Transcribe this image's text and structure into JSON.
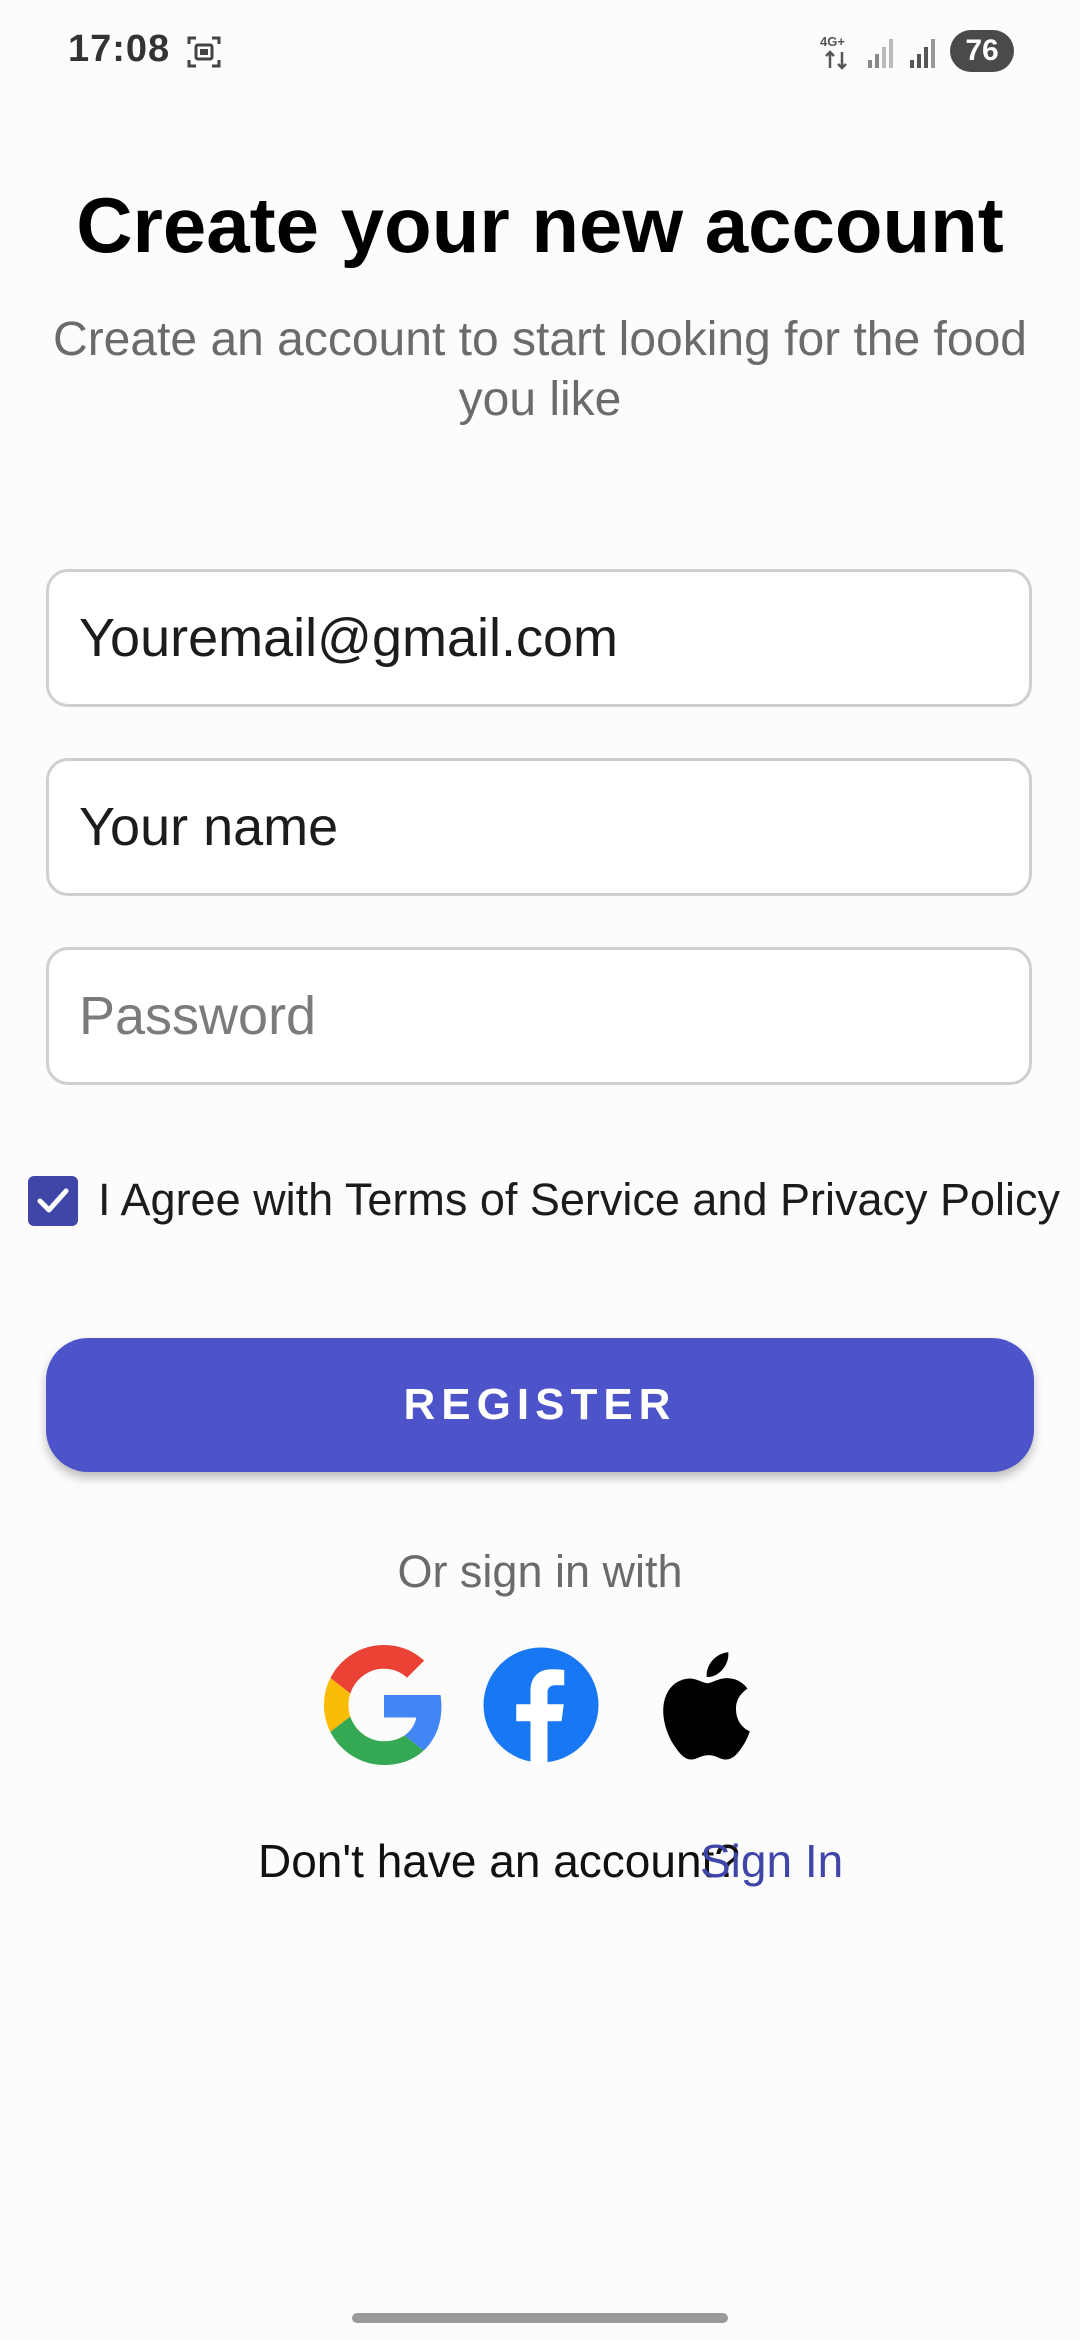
{
  "status_bar": {
    "time": "17:08",
    "battery": "76",
    "network": "4G+"
  },
  "header": {
    "title": "Create your new account",
    "subtitle": "Create an account to start looking for the food you like"
  },
  "form": {
    "email": {
      "value": "Youremail@gmail.com",
      "placeholder": ""
    },
    "name": {
      "value": "Your name",
      "placeholder": ""
    },
    "password": {
      "value": "",
      "placeholder": "Password"
    },
    "terms": {
      "checked": true,
      "label": "I Agree with Terms of Service and Privacy Policy"
    },
    "register_label": "REGISTER"
  },
  "social": {
    "label": "Or sign in with",
    "providers": [
      "google-icon",
      "facebook-icon",
      "apple-icon"
    ]
  },
  "footer": {
    "prompt": "Don't have an account?",
    "link": "Sign In"
  },
  "colors": {
    "accent": "#4d53c8",
    "checkbox": "#3f46a8",
    "link": "#3f46a8"
  }
}
